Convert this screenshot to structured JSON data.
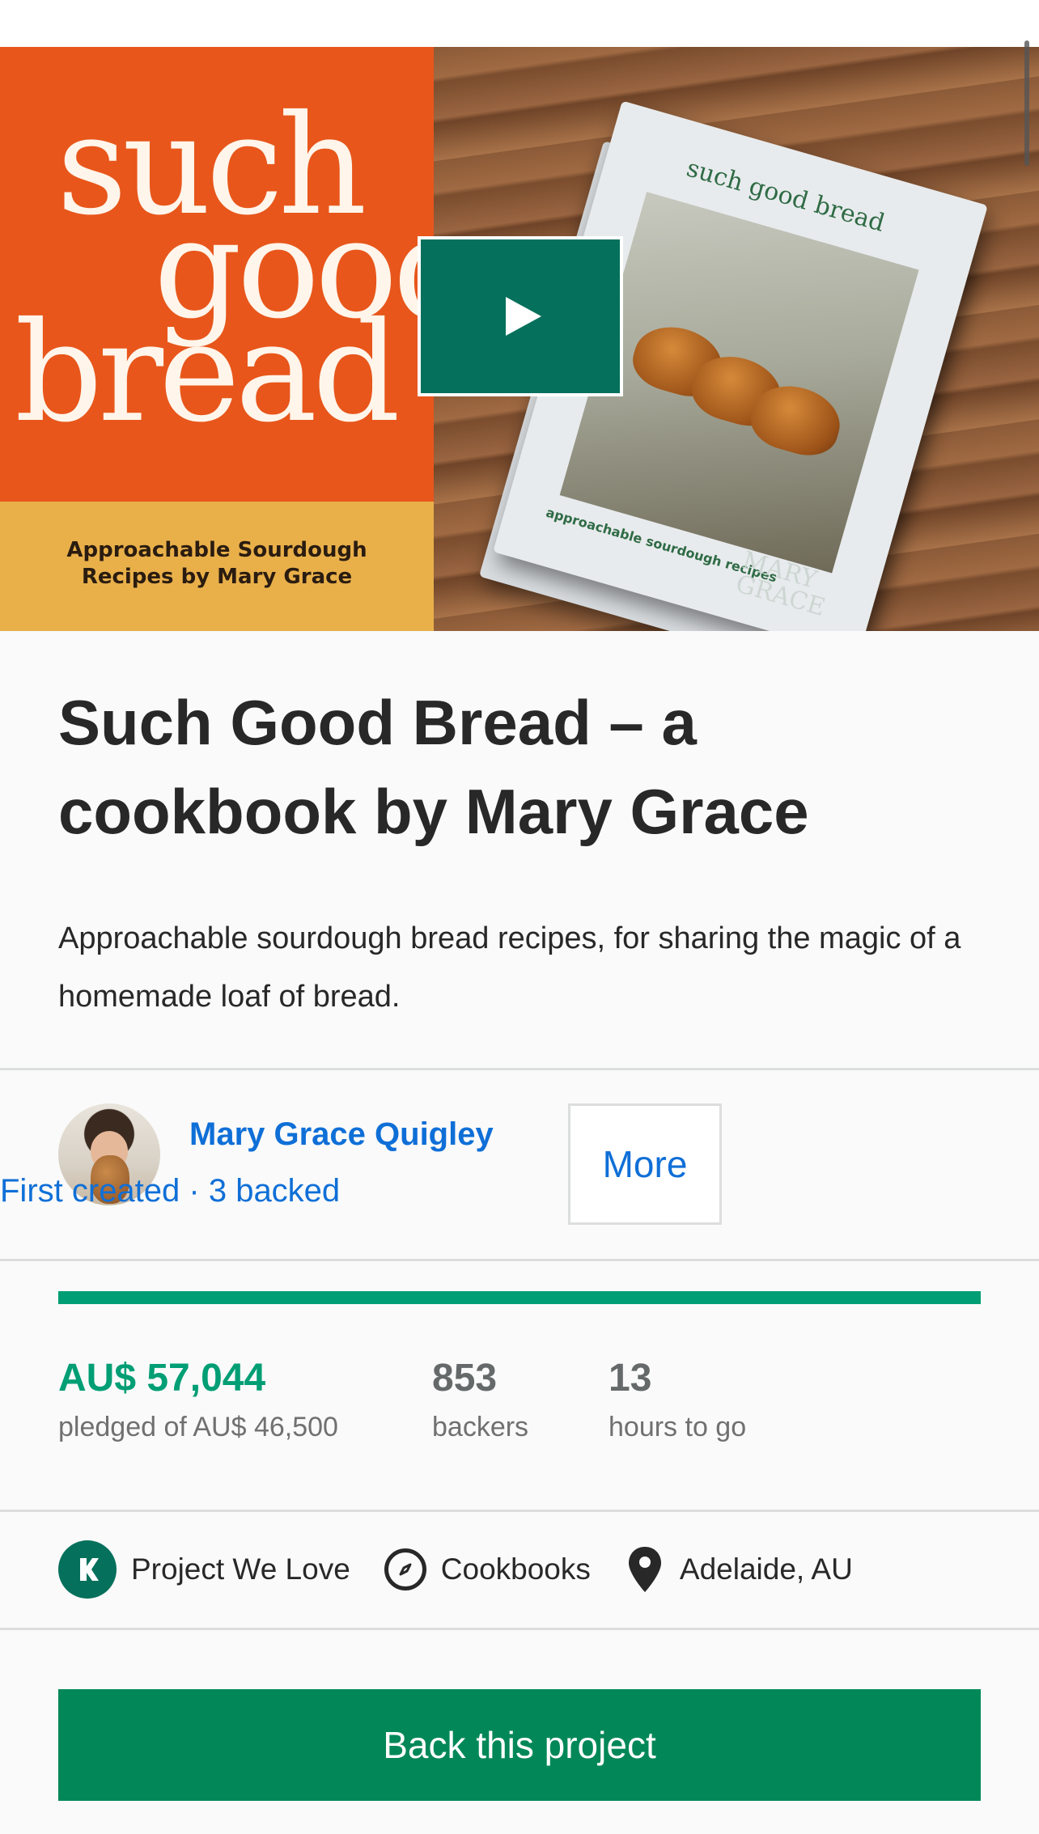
{
  "hero": {
    "cover_title_words": [
      "such",
      "good",
      "bread"
    ],
    "cover_band_text": [
      "Approachable Sourdough",
      "Recipes by Mary Grace"
    ],
    "book_cover_title": "such good bread",
    "book_subtitle": "approachable sourdough recipes",
    "book_author": [
      "MARY",
      "GRACE"
    ],
    "play_icon": "play-icon"
  },
  "project": {
    "title": "Such Good Bread – a cookbook by Mary Grace",
    "blurb": "Approachable sourdough bread recipes, for sharing the magic of a homemade loaf of bread."
  },
  "creator": {
    "name": "Mary Grace Quigley",
    "meta": "First created · 3 backed",
    "more_label": "More"
  },
  "funding": {
    "progress_fraction": 1.0,
    "pledged": "AU$ 57,044",
    "pledged_label": "pledged of AU$ 46,500",
    "backers": "853",
    "backers_label": "backers",
    "time_left": "13",
    "time_left_label": "hours to go"
  },
  "tags": {
    "project_we_love": "Project We Love",
    "category": "Cookbooks",
    "location": "Adelaide, AU"
  },
  "cta": {
    "back_label": "Back this project"
  },
  "colors": {
    "accent_green": "#009e74",
    "cta_green": "#028858",
    "link_blue": "#0f6fd7",
    "cover_orange": "#e8561b"
  }
}
